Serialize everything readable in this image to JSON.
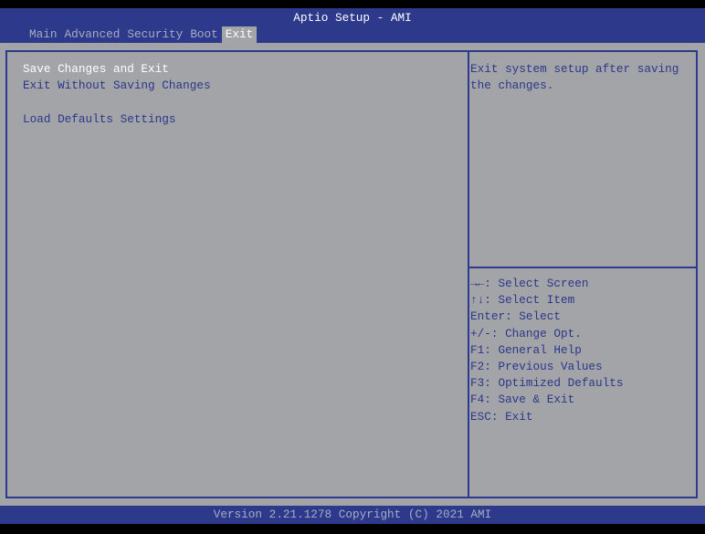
{
  "header": {
    "title": "Aptio Setup - AMI"
  },
  "tabs": [
    {
      "label": "Main"
    },
    {
      "label": "Advanced"
    },
    {
      "label": "Security"
    },
    {
      "label": "Boot"
    },
    {
      "label": "Exit",
      "active": true
    }
  ],
  "menu": {
    "items": [
      {
        "label": "Save Changes and Exit"
      },
      {
        "label": "Exit Without Saving Changes"
      },
      {
        "label": ""
      },
      {
        "label": "Load Defaults Settings"
      }
    ]
  },
  "help": {
    "text": "Exit system setup after saving the changes."
  },
  "keys": [
    "→←: Select Screen",
    "↑↓: Select Item",
    "Enter: Select",
    "+/-: Change Opt.",
    "F1: General Help",
    "F2: Previous Values",
    "F3: Optimized Defaults",
    "F4: Save & Exit",
    "ESC: Exit"
  ],
  "footer": {
    "text": "Version 2.21.1278 Copyright (C) 2021 AMI"
  },
  "colors": {
    "blue": "#2d3a8c",
    "gray": "#a3a4a8"
  }
}
